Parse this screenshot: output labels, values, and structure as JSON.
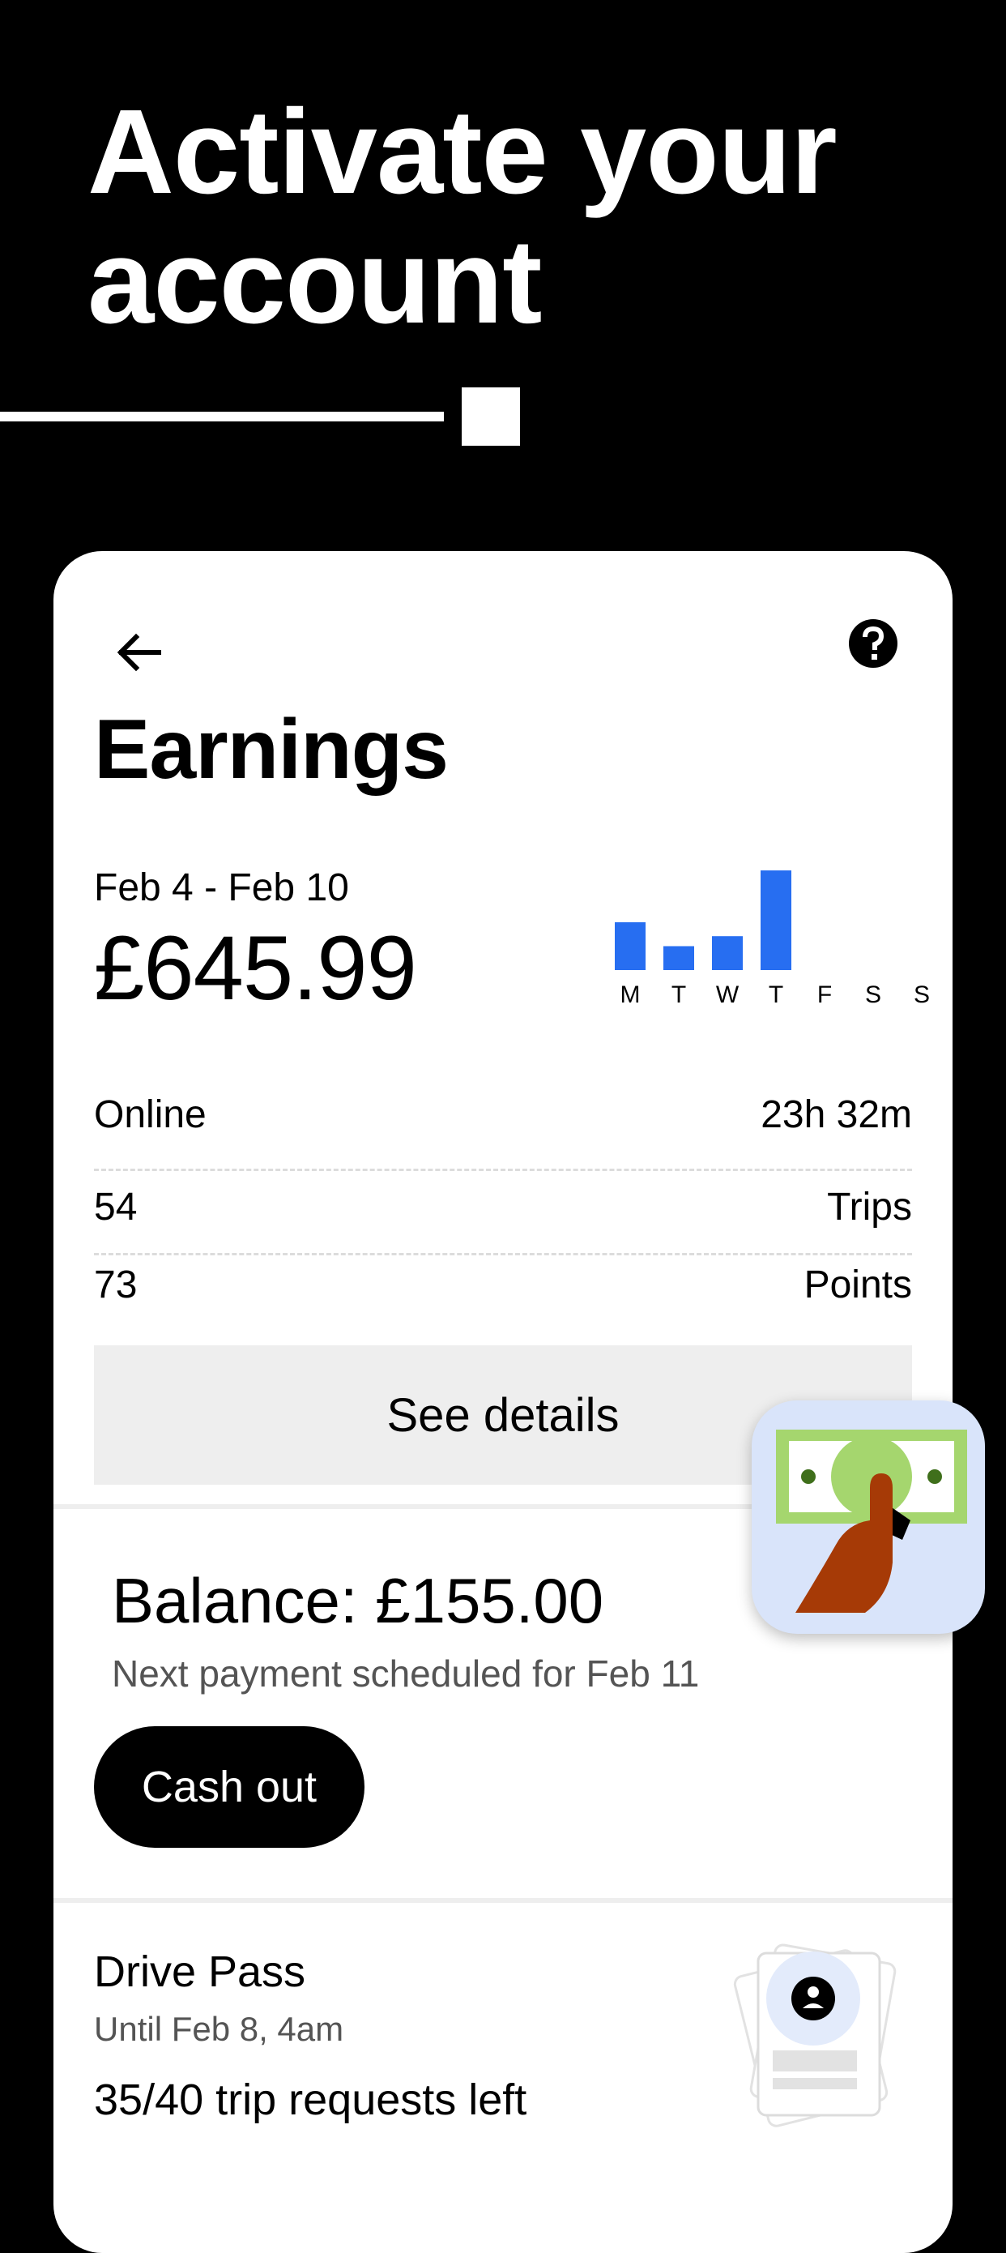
{
  "hero": {
    "title_line1": "Activate your",
    "title_line2": "account"
  },
  "card": {
    "title": "Earnings",
    "date_range": "Feb 4 - Feb 10",
    "amount": "£645.99",
    "chart_days": [
      "M",
      "T",
      "W",
      "T",
      "F",
      "S",
      "S"
    ],
    "chart_levels": [
      0.48,
      0.24,
      0.34,
      1.0,
      0,
      0,
      0
    ],
    "stats": [
      {
        "left": "Online",
        "right": "23h 32m"
      },
      {
        "left": "54",
        "right": "Trips"
      },
      {
        "left": "73",
        "right": "Points"
      }
    ],
    "details_label": "See details"
  },
  "balance": {
    "title": "Balance: £155.00",
    "next_payment": "Next payment scheduled for Feb 11",
    "cashout_label": "Cash out"
  },
  "drive_pass": {
    "title": "Drive Pass",
    "until": "Until Feb 8, 4am",
    "requests_left": "35/40 trip requests left"
  },
  "colors": {
    "background": "#000000",
    "card": "#ffffff",
    "accent_bar": "#276ef1",
    "button_secondary": "#eeeeee",
    "button_primary": "#000000",
    "badge_bg": "#d9e4fa",
    "money_green": "#a5d66e"
  },
  "icons": [
    "back-arrow-icon",
    "help-icon",
    "money-hand-icon",
    "drive-pass-icon"
  ]
}
